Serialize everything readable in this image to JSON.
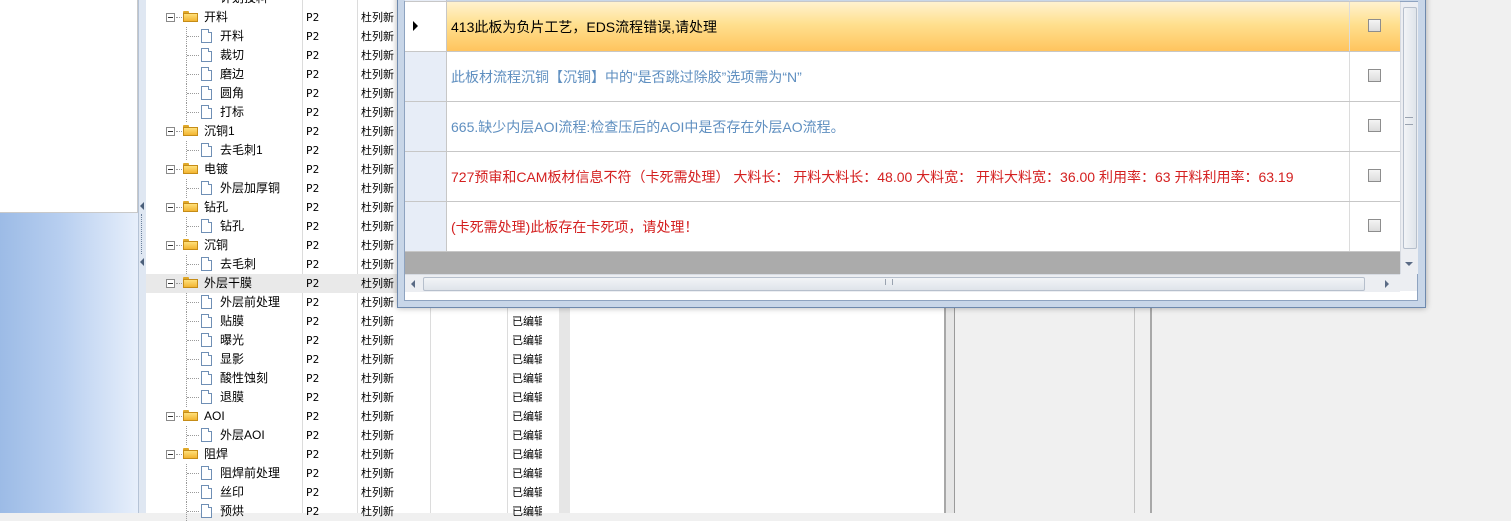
{
  "tree": {
    "top_partial": "计划投料",
    "rows": [
      {
        "name": "开料",
        "kind": "folder",
        "version": "P2",
        "user": "杜列新",
        "status": ""
      },
      {
        "name": "开料",
        "kind": "doc",
        "version": "P2",
        "user": "杜列新",
        "status": ""
      },
      {
        "name": "裁切",
        "kind": "doc",
        "version": "P2",
        "user": "杜列新",
        "status": ""
      },
      {
        "name": "磨边",
        "kind": "doc",
        "version": "P2",
        "user": "杜列新",
        "status": ""
      },
      {
        "name": "圆角",
        "kind": "doc",
        "version": "P2",
        "user": "杜列新",
        "status": ""
      },
      {
        "name": "打标",
        "kind": "doc",
        "version": "P2",
        "user": "杜列新",
        "status": ""
      },
      {
        "name": "沉铜1",
        "kind": "folder",
        "version": "P2",
        "user": "杜列新",
        "status": ""
      },
      {
        "name": "去毛刺1",
        "kind": "doc",
        "version": "P2",
        "user": "杜列新",
        "status": ""
      },
      {
        "name": "电镀",
        "kind": "folder",
        "version": "P2",
        "user": "杜列新",
        "status": ""
      },
      {
        "name": "外层加厚铜",
        "kind": "doc",
        "version": "P2",
        "user": "杜列新",
        "status": ""
      },
      {
        "name": "钻孔",
        "kind": "folder",
        "version": "P2",
        "user": "杜列新",
        "status": ""
      },
      {
        "name": "钻孔",
        "kind": "doc",
        "version": "P2",
        "user": "杜列新",
        "status": ""
      },
      {
        "name": "沉铜",
        "kind": "folder",
        "version": "P2",
        "user": "杜列新",
        "status": ""
      },
      {
        "name": "去毛刺",
        "kind": "doc",
        "version": "P2",
        "user": "杜列新",
        "status": ""
      },
      {
        "name": "外层干膜",
        "kind": "folder",
        "version": "P2",
        "user": "杜列新",
        "status": ""
      },
      {
        "name": "外层前处理",
        "kind": "doc",
        "version": "P2",
        "user": "杜列新",
        "status": ""
      },
      {
        "name": "贴膜",
        "kind": "doc",
        "version": "P2",
        "user": "杜列新",
        "status": "已编辑"
      },
      {
        "name": "曝光",
        "kind": "doc",
        "version": "P2",
        "user": "杜列新",
        "status": "已编辑"
      },
      {
        "name": "显影",
        "kind": "doc",
        "version": "P2",
        "user": "杜列新",
        "status": "已编辑"
      },
      {
        "name": "酸性蚀刻",
        "kind": "doc",
        "version": "P2",
        "user": "杜列新",
        "status": "已编辑"
      },
      {
        "name": "退膜",
        "kind": "doc",
        "version": "P2",
        "user": "杜列新",
        "status": "已编辑"
      },
      {
        "name": "AOI",
        "kind": "folder",
        "version": "P2",
        "user": "杜列新",
        "status": "已编辑"
      },
      {
        "name": "外层AOI",
        "kind": "doc",
        "version": "P2",
        "user": "杜列新",
        "status": "已编辑"
      },
      {
        "name": "阻焊",
        "kind": "folder",
        "version": "P2",
        "user": "杜列新",
        "status": "已编辑"
      },
      {
        "name": "阻焊前处理",
        "kind": "doc",
        "version": "P2",
        "user": "杜列新",
        "status": "已编辑"
      },
      {
        "name": "丝印",
        "kind": "doc",
        "version": "P2",
        "user": "杜列新",
        "status": "已编辑"
      },
      {
        "name": "预烘",
        "kind": "doc",
        "version": "P2",
        "user": "杜列新",
        "status": "已编辑"
      }
    ],
    "selected_index": 14
  },
  "messages": {
    "rows": [
      {
        "text": "413此板为负片工艺，EDS流程错误,请处理",
        "color": "#000000",
        "active": true
      },
      {
        "text": "此板材流程沉铜【沉铜】中的“是否跳过除胶”选项需为“N”",
        "color": "#5f8fc0",
        "active": false
      },
      {
        "text": "665.缺少内层AOI流程:检查压后的AOI中是否存在外层AO流程。",
        "color": "#5f8fc0",
        "active": false
      },
      {
        "text": "727预审和CAM板材信息不符（卡死需处理） 大料长： 开料大料长：48.00 大料宽： 开料大料宽：36.00 利用率：63 开料利用率：63.19",
        "color": "#d42020",
        "active": false
      },
      {
        "text": "(卡死需处理)此板存在卡死项，请处理！",
        "color": "#d42020",
        "active": false
      }
    ]
  }
}
